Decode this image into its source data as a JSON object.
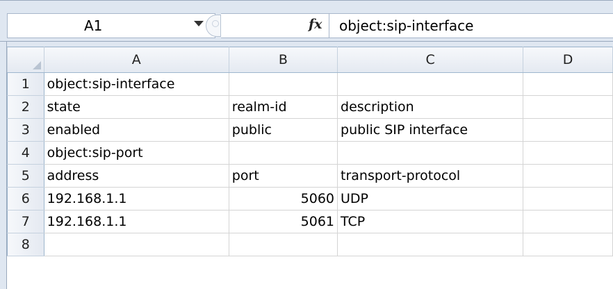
{
  "formula_bar": {
    "name_box": "A1",
    "fx_label": "fx",
    "formula": "object:sip-interface"
  },
  "sheet": {
    "columns": [
      "A",
      "B",
      "C",
      "D"
    ],
    "rows": [
      {
        "num": "1",
        "cells": [
          "object:sip-interface",
          "",
          "",
          ""
        ]
      },
      {
        "num": "2",
        "cells": [
          "state",
          "realm-id",
          "description",
          ""
        ]
      },
      {
        "num": "3",
        "cells": [
          "enabled",
          "public",
          "public SIP interface",
          ""
        ]
      },
      {
        "num": "4",
        "cells": [
          "object:sip-port",
          "",
          "",
          ""
        ]
      },
      {
        "num": "5",
        "cells": [
          "address",
          "port",
          "transport-protocol",
          ""
        ]
      },
      {
        "num": "6",
        "cells": [
          "192.168.1.1",
          "5060",
          "UDP",
          ""
        ]
      },
      {
        "num": "7",
        "cells": [
          "192.168.1.1",
          "5061",
          "TCP",
          ""
        ]
      },
      {
        "num": "8",
        "cells": [
          "",
          "",
          "",
          ""
        ]
      }
    ]
  }
}
